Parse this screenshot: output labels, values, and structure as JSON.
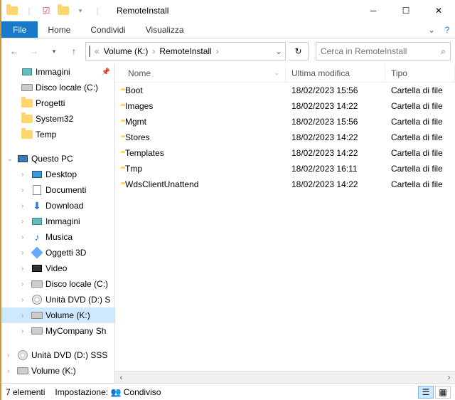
{
  "titlebar": {
    "title": "RemoteInstall"
  },
  "ribbon": {
    "file": "File",
    "tabs": [
      "Home",
      "Condividi",
      "Visualizza"
    ]
  },
  "nav": {
    "breadcrumb": [
      "Volume (K:)",
      "RemoteInstall"
    ],
    "refresh_title": "Aggiorna",
    "search_placeholder": "Cerca in RemoteInstall"
  },
  "sidebar": {
    "upper": [
      {
        "icon": "pic",
        "label": "Immagini",
        "pin": true
      },
      {
        "icon": "disk",
        "label": "Disco locale (C:)"
      },
      {
        "icon": "folder",
        "label": "Progetti"
      },
      {
        "icon": "folder",
        "label": "System32"
      },
      {
        "icon": "folder",
        "label": "Temp"
      }
    ],
    "pc_label": "Questo PC",
    "pc_children": [
      {
        "icon": "desk",
        "label": "Desktop"
      },
      {
        "icon": "doc",
        "label": "Documenti"
      },
      {
        "icon": "dl",
        "label": "Download"
      },
      {
        "icon": "pic",
        "label": "Immagini"
      },
      {
        "icon": "music",
        "label": "Musica"
      },
      {
        "icon": "cube",
        "label": "Oggetti 3D"
      },
      {
        "icon": "video",
        "label": "Video"
      },
      {
        "icon": "disk",
        "label": "Disco locale (C:)"
      },
      {
        "icon": "dvd",
        "label": "Unità DVD (D:) S"
      },
      {
        "icon": "disk",
        "label": "Volume (K:)",
        "selected": true
      },
      {
        "icon": "disk",
        "label": "MyCompany Sh"
      }
    ],
    "lower": [
      {
        "icon": "dvd",
        "label": "Unità DVD (D:) SSS"
      },
      {
        "icon": "disk",
        "label": "Volume (K:)"
      }
    ]
  },
  "columns": {
    "name": "Nome",
    "modified": "Ultima modifica",
    "type": "Tipo"
  },
  "files": [
    {
      "name": "Boot",
      "modified": "18/02/2023 15:56",
      "type": "Cartella di file"
    },
    {
      "name": "Images",
      "modified": "18/02/2023 14:22",
      "type": "Cartella di file"
    },
    {
      "name": "Mgmt",
      "modified": "18/02/2023 15:56",
      "type": "Cartella di file"
    },
    {
      "name": "Stores",
      "modified": "18/02/2023 14:22",
      "type": "Cartella di file"
    },
    {
      "name": "Templates",
      "modified": "18/02/2023 14:22",
      "type": "Cartella di file"
    },
    {
      "name": "Tmp",
      "modified": "18/02/2023 16:11",
      "type": "Cartella di file"
    },
    {
      "name": "WdsClientUnattend",
      "modified": "18/02/2023 14:22",
      "type": "Cartella di file"
    }
  ],
  "status": {
    "count": "7 elementi",
    "state_label": "Impostazione:",
    "state_value": "Condiviso"
  }
}
